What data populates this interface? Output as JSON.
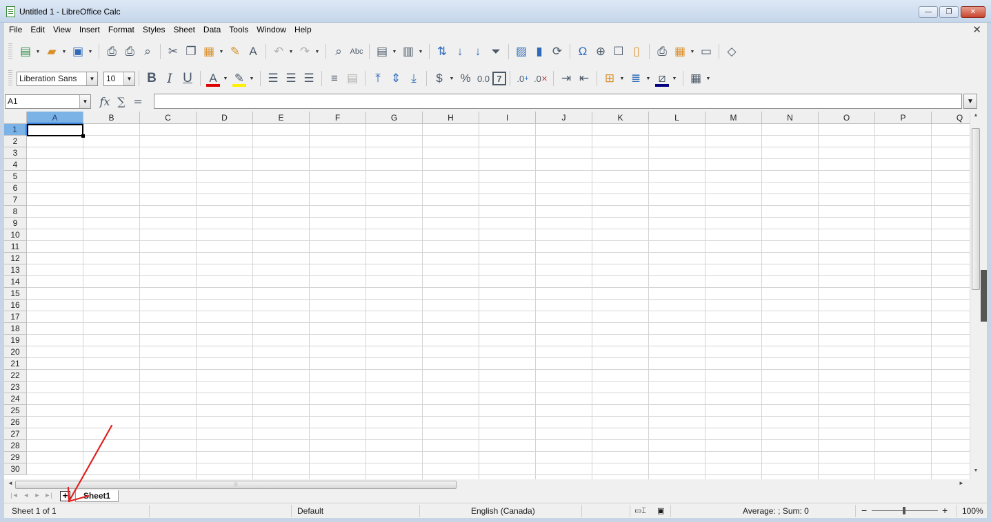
{
  "window": {
    "title": "Untitled 1 - LibreOffice Calc",
    "min": "—",
    "max": "❐",
    "close": "✕"
  },
  "menu": [
    "File",
    "Edit",
    "View",
    "Insert",
    "Format",
    "Styles",
    "Sheet",
    "Data",
    "Tools",
    "Window",
    "Help"
  ],
  "menu_close": "✕",
  "toolbar": {
    "font_name": "Liberation Sans",
    "font_size": "10",
    "bold": "B",
    "italic": "I",
    "underline": "U",
    "currency": "$",
    "percent": "%",
    "number": "0.0",
    "date": "7",
    "add_decimal": ".0",
    "del_decimal": ".0",
    "abc": "Abc",
    "omega": "Ω",
    "font_color": "A",
    "colors": {
      "font_color": "#e00000",
      "highlight": "#ffee00",
      "border_color": "#000080"
    }
  },
  "formula": {
    "cell_ref": "A1",
    "fx": "fx",
    "sigma": "∑",
    "equals": "=",
    "value": ""
  },
  "grid": {
    "columns": [
      "A",
      "B",
      "C",
      "D",
      "E",
      "F",
      "G",
      "H",
      "I",
      "J",
      "K",
      "L",
      "M",
      "N",
      "O",
      "P",
      "Q"
    ],
    "rows": [
      "1",
      "2",
      "3",
      "4",
      "5",
      "6",
      "7",
      "8",
      "9",
      "10",
      "11",
      "12",
      "13",
      "14",
      "15",
      "16",
      "17",
      "18",
      "19",
      "20",
      "21",
      "22",
      "23",
      "24",
      "25",
      "26",
      "27",
      "28",
      "29",
      "30"
    ],
    "selected_cell": "A1"
  },
  "sheets": {
    "add_label": "+",
    "tabs": [
      "Sheet1"
    ],
    "active": "Sheet1"
  },
  "status": {
    "sheet_info": "Sheet 1 of 1",
    "page_style": "Default",
    "language": "English (Canada)",
    "summary": "Average: ; Sum: 0",
    "zoom": "100%",
    "zoom_minus": "−",
    "zoom_plus": "+"
  },
  "icons": {
    "scroll_up": "▲",
    "scroll_down": "▼",
    "scroll_left": "◄",
    "scroll_right": "►",
    "first": "|◄",
    "prev": "◄",
    "next": "►",
    "last": "►|"
  }
}
